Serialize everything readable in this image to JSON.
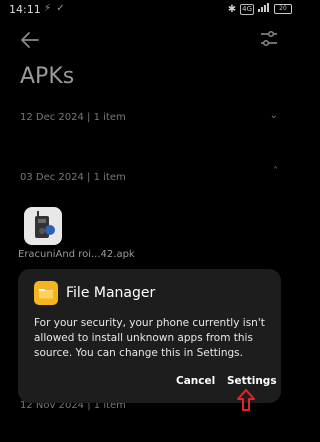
{
  "status_bar": {
    "time": "14:11",
    "left_icons": "⚡ ✓",
    "right_icons": {
      "bluetooth": "✱",
      "signal_label": "4G",
      "battery": "20"
    }
  },
  "toolbar": {
    "back_icon": "arrow-left-icon",
    "filter_icon": "filter-sliders-icon"
  },
  "page": {
    "title": "APKs"
  },
  "groups": [
    {
      "header": "12 Dec 2024  |  1 item",
      "chevron": "⌄"
    },
    {
      "header": "03 Dec 2024  |  1 item",
      "chevron": "˄"
    },
    {
      "header": "12 Nov 2024  |  1 item"
    }
  ],
  "apk": {
    "label": "EracuniAnd roi...42.apk"
  },
  "dialog": {
    "title": "File Manager",
    "message": "For your security, your phone currently isn't allowed to install unknown apps from this source. You can change this in Settings.",
    "cancel_label": "Cancel",
    "settings_label": "Settings"
  },
  "colors": {
    "dialog_bg": "#1d1d1d",
    "folder_icon": "#f5b521",
    "annotation_arrow": "#e0242c"
  }
}
